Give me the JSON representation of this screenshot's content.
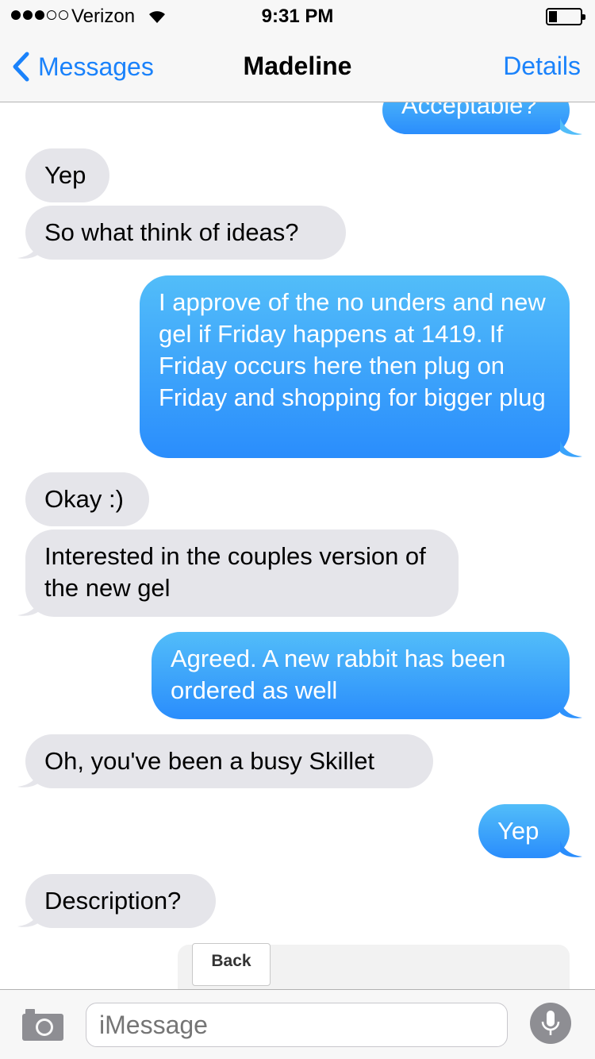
{
  "status_bar": {
    "carrier": "Verizon",
    "time": "9:31 PM",
    "signal_bars_filled": 3,
    "signal_bars_total": 5,
    "battery_level": 0.2
  },
  "nav": {
    "back_label": "Messages",
    "title": "Madeline",
    "details_label": "Details"
  },
  "messages": [
    {
      "from": "me",
      "text": "Acceptable?"
    },
    {
      "from": "them",
      "text": "Yep"
    },
    {
      "from": "them",
      "text": "So what think of ideas?"
    },
    {
      "from": "me",
      "text": "I approve of the no unders and new gel if Friday happens at 1419. If Friday occurs here then plug on Friday and shopping for bigger plug"
    },
    {
      "from": "them",
      "text": "Okay :)"
    },
    {
      "from": "them",
      "text": "Interested in the couples version of the new gel"
    },
    {
      "from": "me",
      "text": "Agreed. A new rabbit has been ordered as well"
    },
    {
      "from": "them",
      "text": "Oh, you've been a busy Skillet"
    },
    {
      "from": "me",
      "text": "Yep"
    },
    {
      "from": "them",
      "text": "Description?"
    }
  ],
  "keyboard": {
    "back_key_label": "Back"
  },
  "input": {
    "placeholder": "iMessage"
  },
  "colors": {
    "accent": "#1a82fb",
    "incoming_bubble": "#e5e5ea",
    "outgoing_top": "#52bdf9",
    "outgoing_bottom": "#2a8dfc"
  }
}
